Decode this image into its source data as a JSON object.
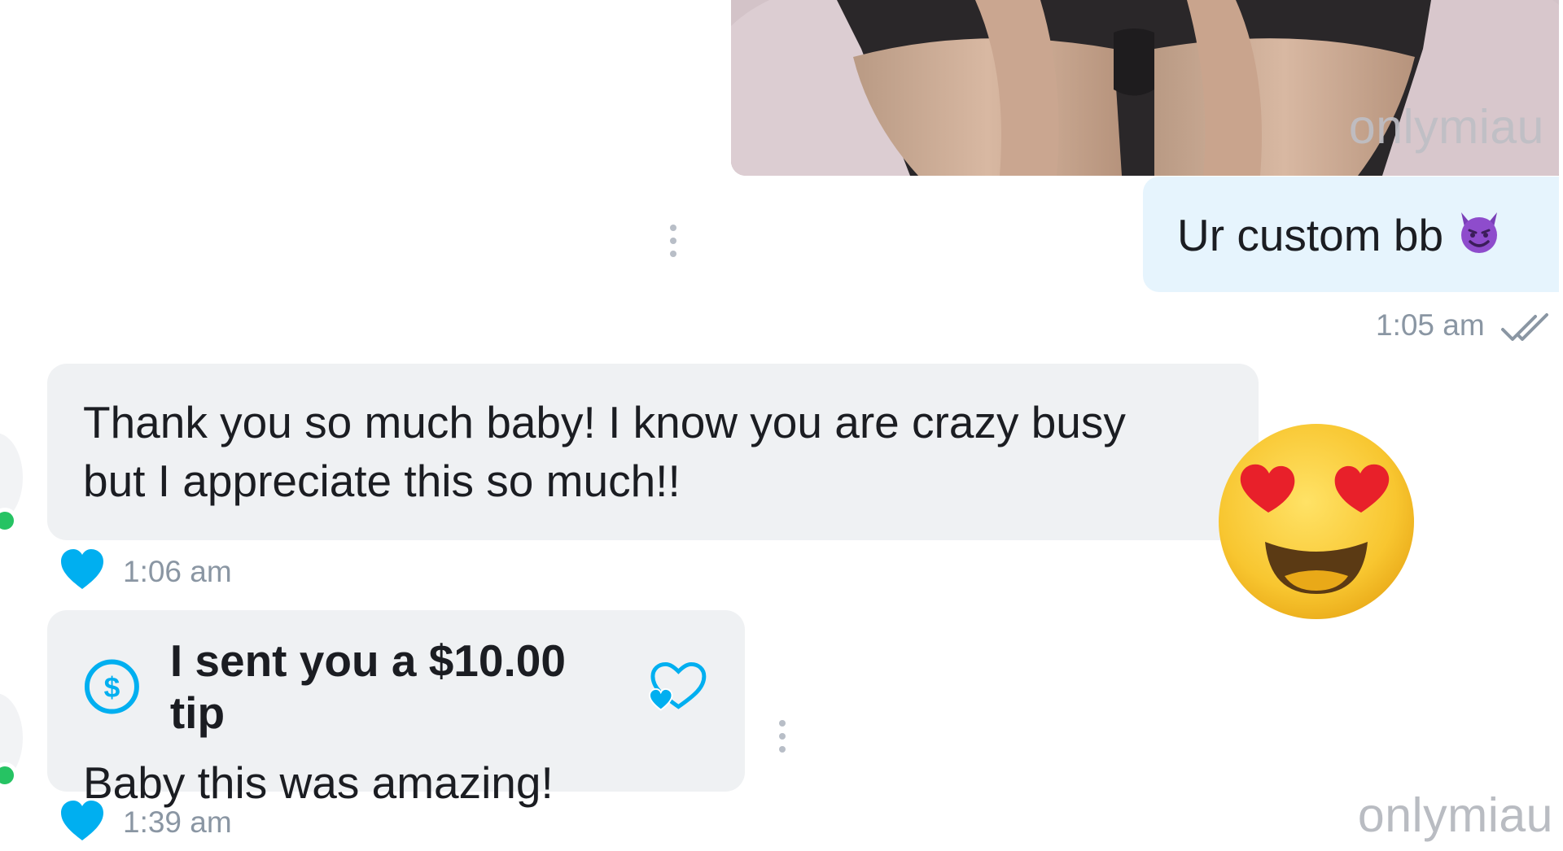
{
  "photo": {
    "watermark": "onlymiau",
    "media_type": "image"
  },
  "outgoing": {
    "text": "Ur custom bb",
    "emoji_icon": "smiling-devil-icon",
    "time": "1:05 am",
    "status_icon": "double-check-icon"
  },
  "messages": [
    {
      "text_line1": "Thank you so much baby! I know you are crazy busy",
      "text_line2": "but I appreciate this so much!!",
      "time": "1:06 am",
      "liked": true
    },
    {
      "tip_label": "I sent you a $10.00 tip",
      "text": "Baby this was amazing!",
      "time": "1:39 am",
      "liked": true
    }
  ],
  "reaction_emoji": "heart-eyes-emoji-icon",
  "watermark": "onlymiau",
  "colors": {
    "accent": "#00aff0",
    "online": "#26c363",
    "outgoing_bubble": "#e6f4fd",
    "incoming_bubble": "#eff1f3"
  }
}
